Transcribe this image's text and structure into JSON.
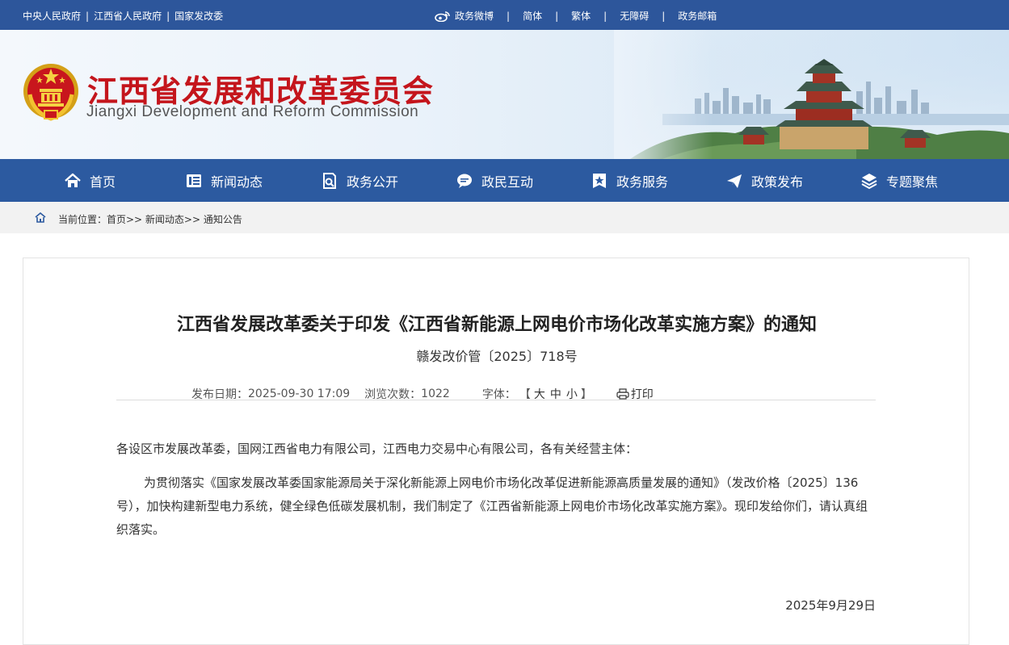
{
  "topbar": {
    "links_left": [
      "中央人民政府",
      "江西省人民政府",
      "国家发改委"
    ],
    "separator": "|",
    "links_right": [
      "政务微博",
      "简体",
      "繁体",
      "无障碍",
      "政务邮箱"
    ]
  },
  "header": {
    "title_cn": "江西省发展和改革委员会",
    "title_en": "Jiangxi Development and Reform Commission"
  },
  "nav": {
    "items": [
      {
        "label": "首页",
        "icon": "home-icon"
      },
      {
        "label": "新闻动态",
        "icon": "news-icon"
      },
      {
        "label": "政务公开",
        "icon": "document-search-icon"
      },
      {
        "label": "政民互动",
        "icon": "chat-icon"
      },
      {
        "label": "政务服务",
        "icon": "star-badge-icon"
      },
      {
        "label": "政策发布",
        "icon": "paper-plane-icon"
      },
      {
        "label": "专题聚焦",
        "icon": "layers-icon"
      }
    ]
  },
  "breadcrumb": {
    "text": "当前位置：首页>> 新闻动态>> 通知公告"
  },
  "article": {
    "title": "江西省发展改革委关于印发《江西省新能源上网电价市场化改革实施方案》的通知",
    "doc_number": "赣发改价管〔2025〕718号",
    "meta": {
      "date_label": "发布日期：",
      "date_value": "2025-09-30 17:09",
      "views_label": "浏览次数：",
      "views_value": "1022",
      "font_label": "字体：",
      "bracket_open": "【",
      "size_large": "大",
      "size_medium": "中",
      "size_small": "小",
      "bracket_close": "】",
      "print_label": "打印"
    },
    "paragraph_1": "各设区市发展改革委，国网江西省电力有限公司，江西电力交易中心有限公司，各有关经营主体：",
    "paragraph_2": "为贯彻落实《国家发展改革委国家能源局关于深化新能源上网电价市场化改革促进新能源高质量发展的通知》（发改价格〔2025〕136号），加快构建新型电力系统，健全绿色低碳发展机制，我们制定了《江西省新能源上网电价市场化改革实施方案》。现印发给你们，请认真组织落实。",
    "signature_date": "2025年9月29日"
  },
  "colors": {
    "topbar_bg": "#2d569b",
    "nav_bg": "#2c5aa0",
    "title_red": "#c4151c"
  }
}
